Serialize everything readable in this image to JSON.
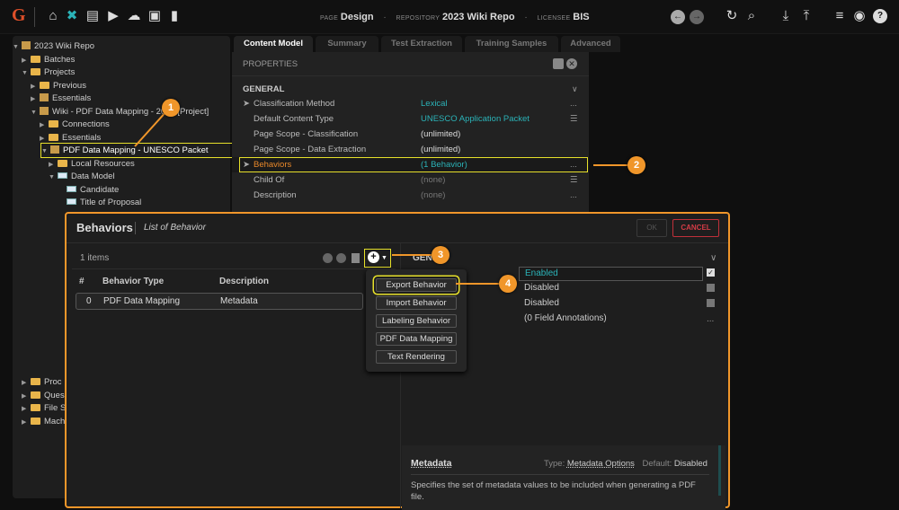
{
  "topbar": {
    "logo": "G",
    "page_label": "PAGE",
    "page": "Design",
    "repo_label": "REPOSITORY",
    "repo": "2023 Wiki Repo",
    "licensee_label": "LICENSEE",
    "licensee": "BIS",
    "sep": "·"
  },
  "tree": {
    "items": [
      {
        "label": "2023 Wiki Repo"
      },
      {
        "label": "Batches"
      },
      {
        "label": "Projects"
      },
      {
        "label": "Previous"
      },
      {
        "label": "Essentials"
      },
      {
        "label": "Wiki - PDF Data Mapping - 2023 [Project]"
      },
      {
        "label": "Connections"
      },
      {
        "label": "Essentials"
      },
      {
        "label": "PDF Data Mapping - UNESCO Packet"
      },
      {
        "label": "Local Resources"
      },
      {
        "label": "Data Model"
      },
      {
        "label": "Candidate"
      },
      {
        "label": "Title of Proposal"
      },
      {
        "label": "Proc"
      },
      {
        "label": "Ques"
      },
      {
        "label": "File S"
      },
      {
        "label": "Mach"
      }
    ]
  },
  "tabs": [
    "Content Model",
    "Summary",
    "Test Extraction",
    "Training Samples",
    "Advanced"
  ],
  "properties": {
    "title": "PROPERTIES",
    "section": "GENERAL",
    "rows": [
      {
        "key": "Classification Method",
        "value": "Lexical",
        "edit": "..."
      },
      {
        "key": "Default Content Type",
        "value": "UNESCO Application Packet",
        "edit": "☰"
      },
      {
        "key": "Page Scope - Classification",
        "value": "(unlimited)",
        "edit": ""
      },
      {
        "key": "Page Scope - Data Extraction",
        "value": "(unlimited)",
        "edit": ""
      },
      {
        "key": "Behaviors",
        "value": "(1 Behavior)",
        "edit": "..."
      },
      {
        "key": "Child Of",
        "value": "(none)",
        "edit": "☰"
      },
      {
        "key": "Description",
        "value": "(none)",
        "edit": "..."
      }
    ]
  },
  "modal": {
    "title": "Behaviors",
    "subtitle": "List of Behavior",
    "ok": "OK",
    "cancel": "CANCEL",
    "count": "1 items",
    "columns": [
      "#",
      "Behavior Type",
      "Description"
    ],
    "rows": [
      {
        "index": "0",
        "type": "PDF Data Mapping",
        "description": "Metadata"
      }
    ],
    "menu": [
      "Export Behavior",
      "Import Behavior",
      "Labeling Behavior",
      "PDF Data Mapping",
      "Text Rendering"
    ],
    "right": {
      "section": "GENE",
      "rows": [
        {
          "label": "",
          "value": "Enabled",
          "checked": true
        },
        {
          "label": "ng",
          "value": "Disabled"
        },
        {
          "label": "",
          "value": "Disabled"
        },
        {
          "label": "s",
          "value": "(0 Field Annotations)",
          "edit": "..."
        }
      ],
      "help": {
        "name": "Metadata",
        "type_label": "Type:",
        "type": "Metadata Options",
        "default_label": "Default:",
        "default": "Disabled",
        "text": "Specifies the set of metadata values to be included when generating a PDF file."
      }
    }
  },
  "callouts": [
    "1",
    "2",
    "3",
    "4"
  ],
  "colors": {
    "accent": "#f0962a",
    "highlight": "#e6e02a",
    "link": "#2bb3b8",
    "cancel": "#c0303a"
  }
}
